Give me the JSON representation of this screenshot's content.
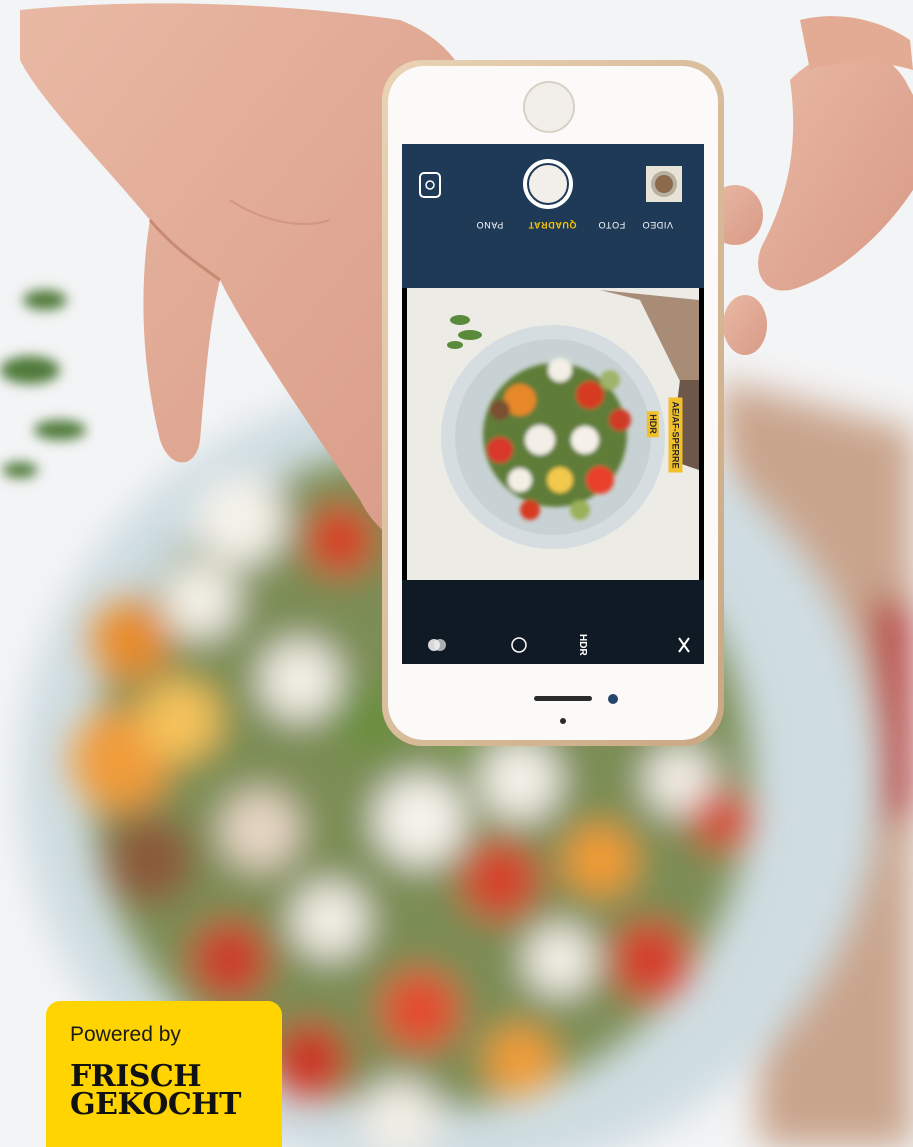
{
  "camera": {
    "modes": [
      "VIDEO",
      "FOTO",
      "QUADRAT",
      "PANO"
    ],
    "active_mode": "QUADRAT",
    "hdr_label": "HDR",
    "hdr_badge": "HDR",
    "ae_lock_label": "AE/AF-SPERRE"
  },
  "badge": {
    "powered_by": "Powered by",
    "brand_line1": "FRISCH",
    "brand_line2": "GEKOCHT"
  },
  "colors": {
    "badge_yellow": "#ffd400",
    "camera_accent": "#f2c02a",
    "camera_bar": "#1f3a56"
  }
}
